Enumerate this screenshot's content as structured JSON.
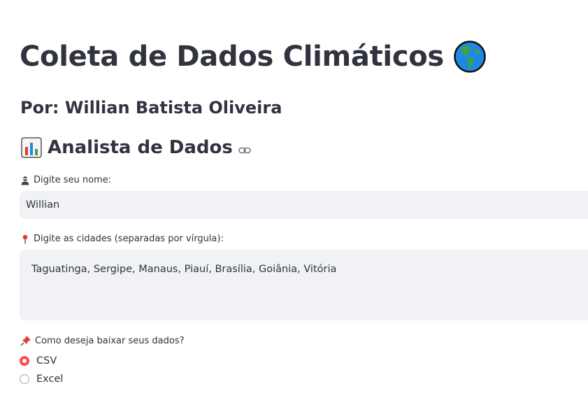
{
  "header": {
    "title": "Coleta de Dados Climáticos",
    "title_icon": "globe-americas-icon",
    "subtitle": "Por: Willian Batista Oliveira"
  },
  "section": {
    "icon": "bar-chart-icon",
    "heading": "Analista de Dados",
    "anchor_icon": "link-icon"
  },
  "name_field": {
    "icon": "person-icon",
    "label": "Digite seu nome:",
    "value": "Willian"
  },
  "cities_field": {
    "icon": "round-pushpin-icon",
    "label": "Digite as cidades (separadas por vírgula):",
    "value": "Taguatinga, Sergipe, Manaus, Piauí, Brasília, Goiânia, Vitória"
  },
  "download": {
    "icon": "pushpin-icon",
    "label": "Como deseja baixar seus dados?",
    "options": [
      {
        "label": "CSV",
        "selected": true
      },
      {
        "label": "Excel",
        "selected": false
      }
    ]
  },
  "colors": {
    "accent": "#ff4b4b",
    "text": "#31333f",
    "input_bg": "#f0f2f6"
  }
}
